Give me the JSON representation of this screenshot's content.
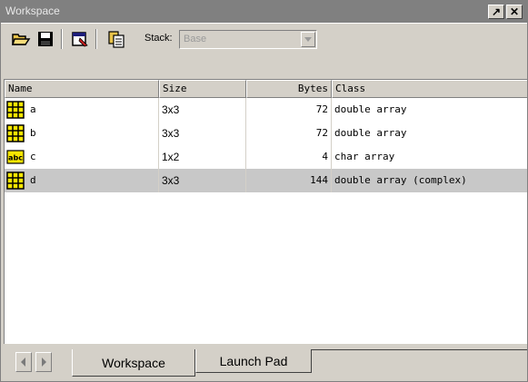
{
  "window": {
    "title": "Workspace",
    "undock_label": "↗",
    "close_label": "✕"
  },
  "toolbar": {
    "icons": [
      "open-folder-icon",
      "save-disk-icon",
      "print-icon",
      "import-data-icon"
    ],
    "stack_label": "Stack:",
    "stack_value": "Base"
  },
  "table": {
    "columns": [
      "Name",
      "Size",
      "Bytes",
      "Class"
    ],
    "rows": [
      {
        "icon": "matrix-grid-icon",
        "name": "a",
        "size": "3x3",
        "bytes": "72",
        "class": "double array"
      },
      {
        "icon": "matrix-grid-icon",
        "name": "b",
        "size": "3x3",
        "bytes": "72",
        "class": "double array"
      },
      {
        "icon": "abc-char-icon",
        "name": "c",
        "size": "1x2",
        "bytes": "4",
        "class": "char array"
      },
      {
        "icon": "matrix-grid-icon",
        "name": "d",
        "size": "3x3",
        "bytes": "144",
        "class": "double array (complex)",
        "selected": true
      }
    ]
  },
  "tabs": {
    "active": "Workspace",
    "inactive": "Launch Pad"
  },
  "colors": {
    "window_bg": "#d4d0c8",
    "title_bg": "#808080",
    "selected_row": "#c8c8c8",
    "matrix_icon_fill": "#f7e600"
  }
}
